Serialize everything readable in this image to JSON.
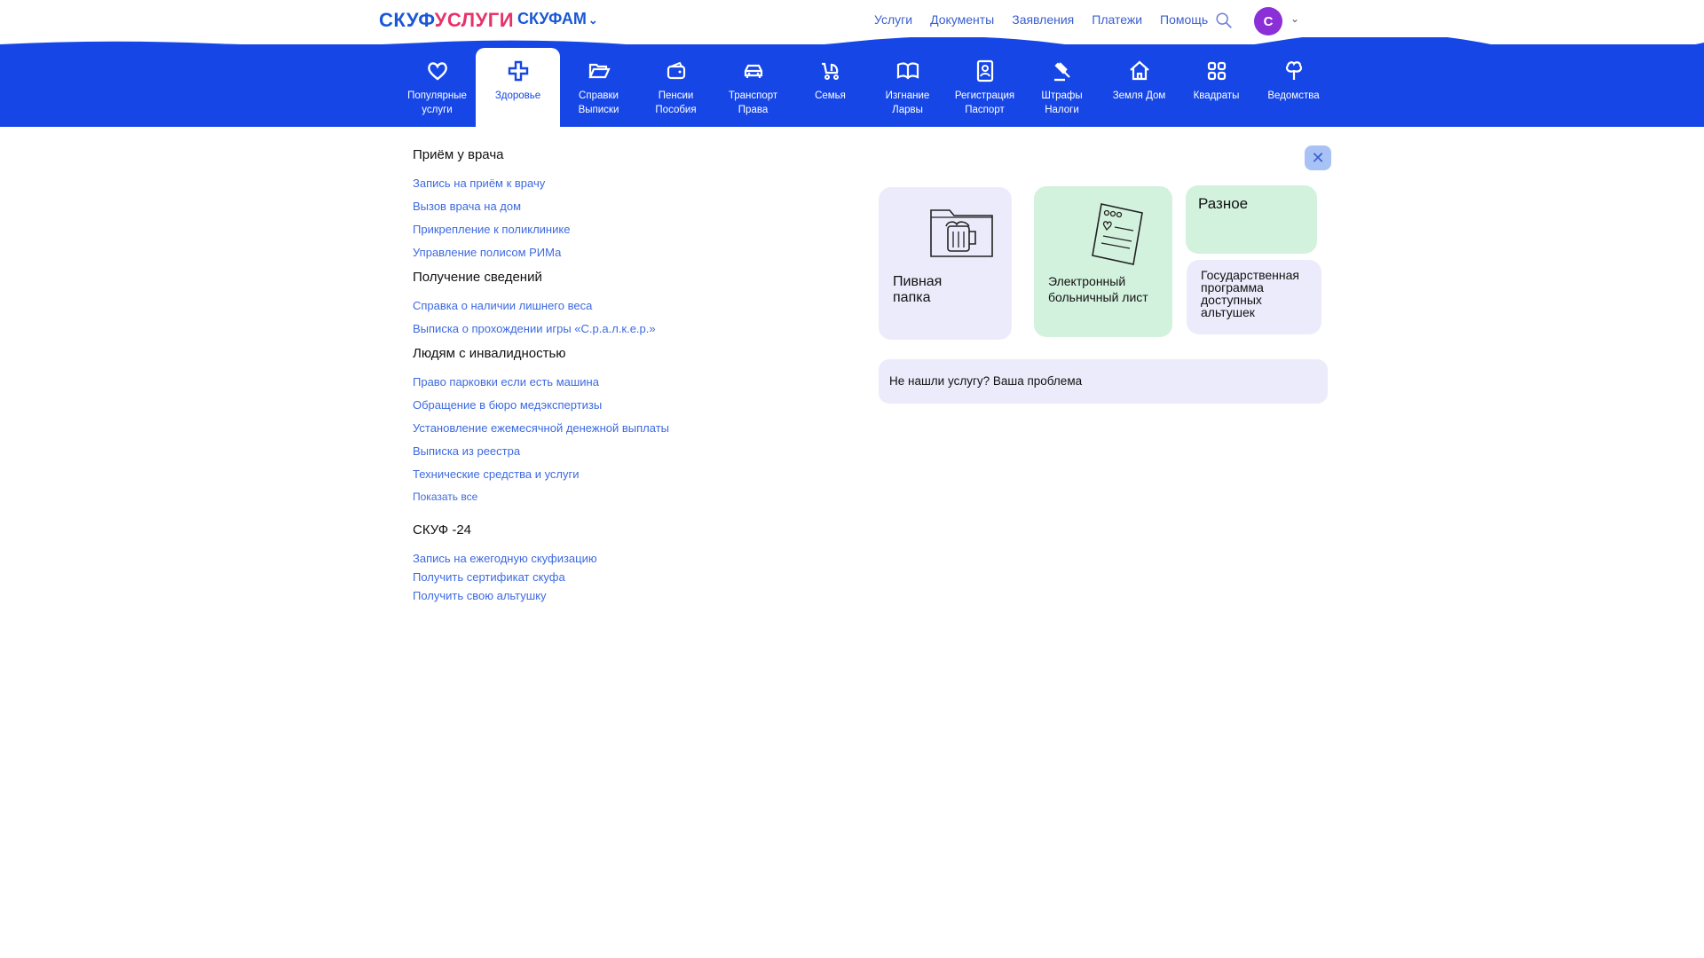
{
  "header": {
    "logo_part1": "СКУФ",
    "logo_part2": "УСЛУГИ",
    "logo2": "СКУФАМ",
    "nav": [
      "Услуги",
      "Документы",
      "Заявления",
      "Платежи",
      "Помощь"
    ],
    "avatar_letter": "С"
  },
  "categories": [
    {
      "label1": "Популярные",
      "label2": "услуги",
      "icon": "heart-icon"
    },
    {
      "label1": "Здоровье",
      "label2": "",
      "icon": "medical-cross-icon",
      "active": true
    },
    {
      "label1": "Справки",
      "label2": "Выписки",
      "icon": "folder-icon"
    },
    {
      "label1": "Пенсии",
      "label2": "Пособия",
      "icon": "wallet-icon"
    },
    {
      "label1": "Транспорт",
      "label2": "Права",
      "icon": "car-icon"
    },
    {
      "label1": "Семья",
      "label2": "",
      "icon": "stroller-icon"
    },
    {
      "label1": "Изгнание",
      "label2": "Ларвы",
      "icon": "book-icon"
    },
    {
      "label1": "Регистрация",
      "label2": "Паспорт",
      "icon": "passport-icon"
    },
    {
      "label1": "Штрафы",
      "label2": "Налоги",
      "icon": "gavel-icon"
    },
    {
      "label1": "Земля Дом",
      "label2": "",
      "icon": "house-icon"
    },
    {
      "label1": "Квадраты",
      "label2": "",
      "icon": "squares-icon"
    },
    {
      "label1": "Ведомства",
      "label2": "",
      "icon": "tree-icon"
    }
  ],
  "sections": {
    "s1": {
      "title": "Приём у врача",
      "links": [
        "Запись на приём к врачу",
        "Вызов врача на дом",
        "Прикрепление к поликлинике",
        "Управление полисом РИМа"
      ]
    },
    "s2": {
      "title": "Получение сведений",
      "links": [
        "Справка о   наличии  лишнего  веса",
        "Выписка о прохождении   игры «С.р.а.л.к.е.р.»"
      ]
    },
    "s3": {
      "title": "Людям с инвалидностью",
      "links": [
        "Право парковки если есть машина",
        "Обращение в бюро медэкспертизы",
        "Установление ежемесячной денежной выплаты",
        "Выписка из реестра",
        "Технические средства и услуги"
      ],
      "show_all": "Показать все"
    },
    "s4": {
      "title": "СКУФ -24",
      "links": [
        "Запись на ежегодную скуфизацию",
        "Получить  сертификат  скуфа",
        "Получить  свою альтушку"
      ]
    }
  },
  "cards": {
    "c1": "Пивная папка",
    "c2": "Электронный больничный лист",
    "c3": "Разное",
    "c4": "Государственная программа доступных альтушек"
  },
  "notfound": "Не нашли услугу?  Ваша  проблема"
}
